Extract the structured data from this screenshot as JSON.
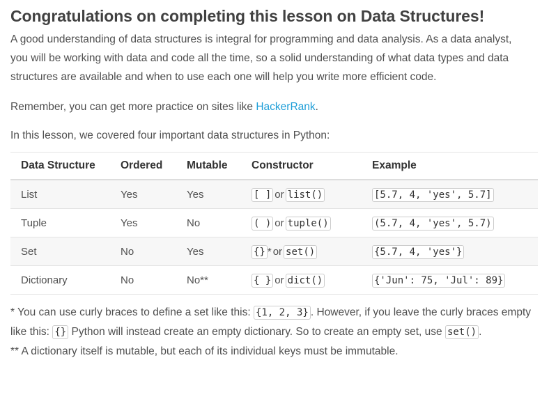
{
  "title": "Congratulations on completing this lesson on Data Structures!",
  "intro": "A good understanding of data structures is integral for programming and data analysis. As a data analyst, you will be working with data and code all the time, so a solid understanding of what data types and data structures are available and when to use each one will help you write more efficient code.",
  "remember": {
    "before": "Remember, you can get more practice on sites like ",
    "link_text": "HackerRank",
    "after": "."
  },
  "covered": "In this lesson, we covered four important data structures in Python:",
  "table": {
    "headers": [
      "Data Structure",
      "Ordered",
      "Mutable",
      "Constructor",
      "Example"
    ],
    "or_word": "or",
    "rows": [
      {
        "name": "List",
        "ordered": "Yes",
        "mutable": "Yes",
        "ctor1": "[ ]",
        "ctor_suffix": "",
        "ctor2": "list()",
        "example": "[5.7, 4, 'yes', 5.7]"
      },
      {
        "name": "Tuple",
        "ordered": "Yes",
        "mutable": "No",
        "ctor1": "( )",
        "ctor_suffix": "",
        "ctor2": "tuple()",
        "example": "(5.7, 4, 'yes', 5.7)"
      },
      {
        "name": "Set",
        "ordered": "No",
        "mutable": "Yes",
        "ctor1": "{}",
        "ctor_suffix": "*",
        "ctor2": "set()",
        "example": "{5.7, 4, 'yes'}"
      },
      {
        "name": "Dictionary",
        "ordered": "No",
        "mutable": "No**",
        "ctor1": "{ }",
        "ctor_suffix": "",
        "ctor2": "dict()",
        "example": "{'Jun': 75, 'Jul': 89}"
      }
    ]
  },
  "note1": {
    "a": "* You can use curly braces to define a set like this: ",
    "code1": "{1, 2, 3}",
    "b": ". However, if you leave the curly braces empty like this: ",
    "code2": "{}",
    "c": " Python will instead create an empty dictionary. So to create an empty set, use ",
    "code3": "set()",
    "d": "."
  },
  "note2": "** A dictionary itself is mutable, but each of its individual keys must be immutable."
}
